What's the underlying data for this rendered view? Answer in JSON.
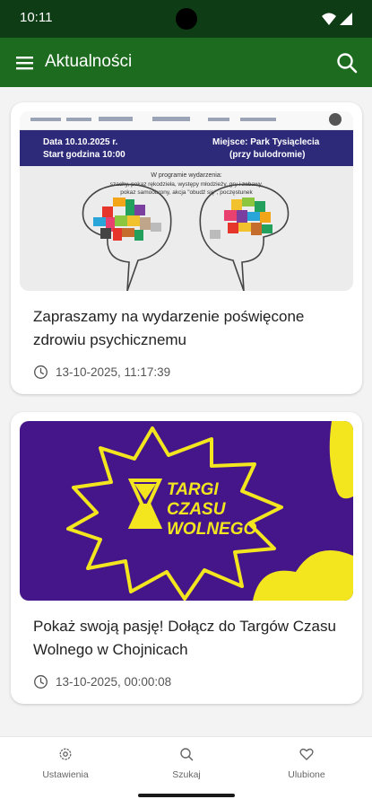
{
  "status": {
    "time": "10:11"
  },
  "app_bar": {
    "title": "Aktualności"
  },
  "news": [
    {
      "title": "Zapraszamy na wydarzenie poświęcone zdrowiu psychicznemu",
      "date": "13-10-2025, 11:17:39",
      "poster": {
        "left_line1": "Data 10.10.2025 r.",
        "left_line2": "Start godzina 10:00",
        "right_line1": "Miejsce: Park Tysiąclecia",
        "right_line2": "(przy bulodromie)",
        "program_heading": "W programie wydarzenia:",
        "program_line1": "szachy, pokaz rękodzieła, występy młodzieży, gry i zabawy,",
        "program_line2": "pokaz samoobrony, akcja \"obudź się\", poczęstunek"
      }
    },
    {
      "title": "Pokaż swoją pasję! Dołącz do Targów Czasu Wolnego w Chojnicach",
      "date": "13-10-2025, 00:00:08",
      "poster": {
        "line1": "TARGI",
        "line2": "CZASU",
        "line3": "WOLNEGO"
      }
    }
  ],
  "bottom_nav": [
    {
      "label": "Ustawienia",
      "icon": "gear-icon"
    },
    {
      "label": "Szukaj",
      "icon": "search-icon"
    },
    {
      "label": "Ulubione",
      "icon": "heart-icon"
    }
  ],
  "colors": {
    "status_bar": "#0e3c14",
    "app_bar": "#1d6b1e",
    "poster_purple": "#45168a",
    "poster_yellow": "#f3e61f",
    "poster_navy": "#2d2a7a"
  }
}
